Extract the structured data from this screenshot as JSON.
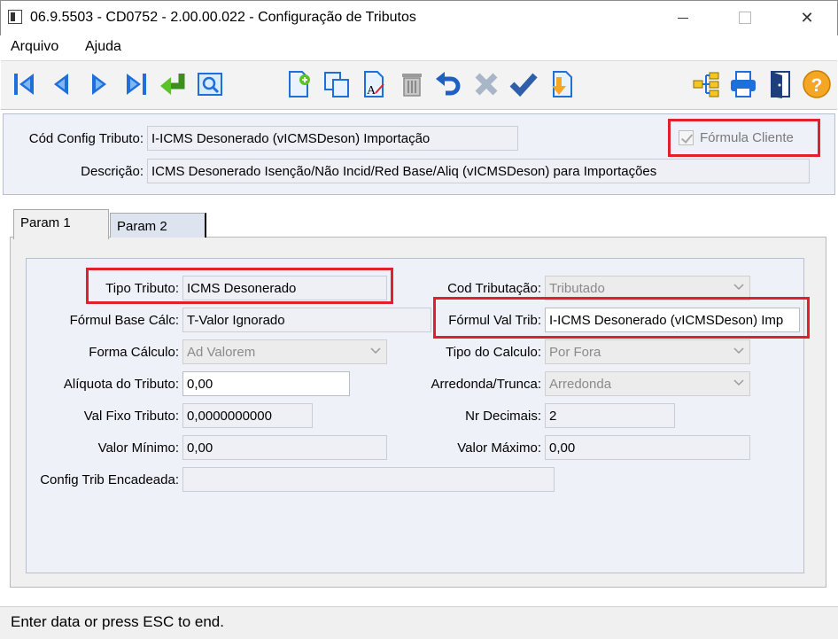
{
  "window": {
    "title": "06.9.5503 - CD0752 - 2.00.00.022 - Configuração de Tributos",
    "minimize_glyph": "",
    "maximize_glyph": "",
    "close_glyph": "✕"
  },
  "menu": {
    "items": [
      {
        "label": "Arquivo"
      },
      {
        "label": "Ajuda"
      }
    ]
  },
  "toolbar": {
    "buttons": [
      "first-record-icon",
      "previous-record-icon",
      "next-record-icon",
      "last-record-icon",
      "go-to-icon",
      "search-icon",
      "new-record-icon",
      "copy-record-icon",
      "edit-record-icon",
      "delete-record-icon",
      "undo-icon",
      "cancel-icon",
      "confirm-icon",
      "import-icon",
      "tree-icon",
      "print-icon",
      "exit-icon",
      "help-icon"
    ]
  },
  "header": {
    "cod_config_label": "Cód Config Tributo:",
    "cod_config_value": "I-ICMS Desonerado (vICMSDeson) Importação",
    "descricao_label": "Descrição:",
    "descricao_value": "ICMS Desonerado Isenção/Não Incid/Red Base/Aliq (vICMSDeson) para Importações",
    "formula_cliente_label": "Fórmula Cliente",
    "formula_cliente_checked": true
  },
  "tabs": [
    {
      "label": "Param 1",
      "active": true
    },
    {
      "label": "Param 2",
      "active": false
    }
  ],
  "param1": {
    "tipo_tributo_label": "Tipo Tributo:",
    "tipo_tributo_value": "ICMS Desonerado",
    "formul_base_label": "Fórmul Base Cálc:",
    "formul_base_value": "T-Valor Ignorado",
    "forma_calculo_label": "Forma Cálculo:",
    "forma_calculo_value": "Ad Valorem",
    "aliquota_label": "Alíquota do Tributo:",
    "aliquota_value": "0,00",
    "val_fixo_label": "Val Fixo Tributo:",
    "val_fixo_value": "0,0000000000",
    "valor_minimo_label": "Valor Mínimo:",
    "valor_minimo_value": "0,00",
    "config_trib_label": "Config Trib Encadeada:",
    "config_trib_value": "",
    "cod_tributacao_label": "Cod Tributação:",
    "cod_tributacao_value": "Tributado",
    "formul_val_label": "Fórmul Val Trib:",
    "formul_val_value": "I-ICMS Desonerado (vICMSDeson) Imp",
    "tipo_calculo_label": "Tipo do Calculo:",
    "tipo_calculo_value": "Por Fora",
    "arredonda_label": "Arredonda/Trunca:",
    "arredonda_value": "Arredonda",
    "nr_decimais_label": "Nr Decimais:",
    "nr_decimais_value": "2",
    "valor_maximo_label": "Valor Máximo:",
    "valor_maximo_value": "0,00"
  },
  "status": {
    "text": "Enter data or press ESC to end."
  },
  "colors": {
    "highlight_red": "#e0202a",
    "toolbar_blue": "#1e6fd9",
    "group_background": "#eef1f8"
  }
}
